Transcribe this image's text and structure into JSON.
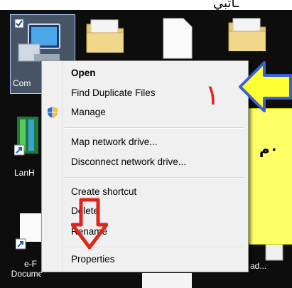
{
  "desktop": {
    "top_text": "ـاتبي",
    "icons": [
      {
        "label": "Com"
      },
      {
        "label": "LanH"
      },
      {
        "label": "e-F\nDocume..."
      },
      {
        "label": "ad..."
      }
    ],
    "yellow_box_text": "٠م"
  },
  "context_menu": {
    "items": [
      {
        "label": "Open"
      },
      {
        "label": "Find Duplicate Files"
      },
      {
        "label": "Manage",
        "icon": "shield-icon"
      },
      {
        "label": "Map network drive..."
      },
      {
        "label": "Disconnect network drive..."
      },
      {
        "label": "Create shortcut"
      },
      {
        "label": "Delete"
      },
      {
        "label": "Rename"
      },
      {
        "label": "Properties"
      }
    ]
  },
  "annotations": {
    "number_label": "١",
    "colors": {
      "red": "#e0241b",
      "yellow": "#ffff33",
      "arrow_border": "#3a5fd8"
    }
  }
}
